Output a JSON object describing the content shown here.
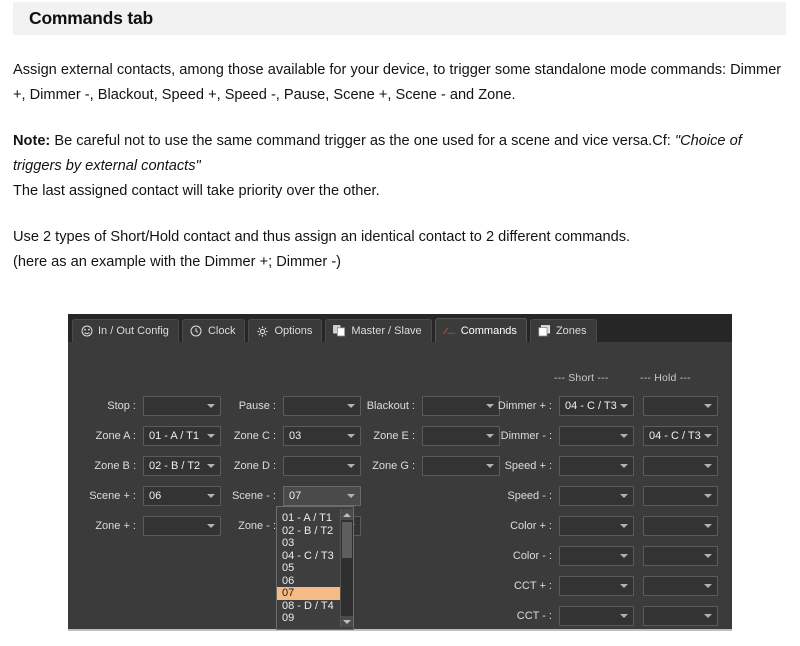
{
  "document": {
    "title": "Commands tab",
    "paragraphs": [
      {
        "id": "p1",
        "text": "Assign external contacts, among those available for your device, to trigger some standalone mode commands: Dimmer +, Dimmer -, Blackout, Speed +, Speed -, Pause, Scene +, Scene - and Zone."
      },
      {
        "id": "p2_note_label",
        "text": "Note:"
      },
      {
        "id": "p2_note_body",
        "text": " Be careful not to use the same command trigger as the one used for a scene and vice versa.Cf: "
      },
      {
        "id": "p2_note_quote",
        "text": "\"Choice of triggers by external contacts\""
      },
      {
        "id": "p3",
        "text": "The last assigned contact will take priority over the other."
      },
      {
        "id": "p4",
        "text": "Use 2 types of Short/Hold contact and thus assign an identical contact to 2 different commands."
      },
      {
        "id": "p5",
        "text": "(here as an example with the Dimmer +; Dimmer -)"
      }
    ]
  },
  "app": {
    "tabs": [
      {
        "label": "In / Out Config",
        "icon": "in-out-config-icon",
        "active": false
      },
      {
        "label": "Clock",
        "icon": "clock-icon",
        "active": false
      },
      {
        "label": "Options",
        "icon": "gear-icon",
        "active": false
      },
      {
        "label": "Master / Slave",
        "icon": "master-slave-icon",
        "active": false
      },
      {
        "label": "Commands",
        "icon": "commands-icon",
        "active": true
      },
      {
        "label": "Zones",
        "icon": "zones-icon",
        "active": false
      }
    ],
    "column_headers": {
      "short": "--- Short ---",
      "hold": "--- Hold ---"
    },
    "fields": {
      "stop": {
        "label": "Stop :",
        "value": ""
      },
      "zone_a": {
        "label": "Zone A :",
        "value": "01 - A / T1"
      },
      "zone_b": {
        "label": "Zone B :",
        "value": "02 - B / T2"
      },
      "scene_plus": {
        "label": "Scene + :",
        "value": "06"
      },
      "zone_plus": {
        "label": "Zone + :",
        "value": ""
      },
      "pause": {
        "label": "Pause :",
        "value": ""
      },
      "zone_c": {
        "label": "Zone C :",
        "value": "03"
      },
      "zone_d": {
        "label": "Zone D :",
        "value": ""
      },
      "scene_minus": {
        "label": "Scene - :",
        "value": "07"
      },
      "zone_minus": {
        "label": "Zone - :",
        "value": ""
      },
      "blackout": {
        "label": "Blackout :",
        "value": ""
      },
      "zone_e": {
        "label": "Zone E :",
        "value": ""
      },
      "zone_g": {
        "label": "Zone G :",
        "value": ""
      },
      "dimmer_plus": {
        "label": "Dimmer + :",
        "short": "04 - C / T3",
        "hold": ""
      },
      "dimmer_minus": {
        "label": "Dimmer - :",
        "short": "",
        "hold": "04 - C / T3"
      },
      "speed_plus": {
        "label": "Speed + :",
        "short": "",
        "hold": ""
      },
      "speed_minus": {
        "label": "Speed - :",
        "short": "",
        "hold": ""
      },
      "color_plus": {
        "label": "Color + :",
        "short": "",
        "hold": ""
      },
      "color_minus": {
        "label": "Color - :",
        "short": "",
        "hold": ""
      },
      "cct_plus": {
        "label": "CCT + :",
        "short": "",
        "hold": ""
      },
      "cct_minus": {
        "label": "CCT - :",
        "short": "",
        "hold": ""
      }
    },
    "dropdown": {
      "open_for": "scene_minus",
      "selected": "07",
      "items": [
        "01 - A / T1",
        "02 - B / T2",
        "03",
        "04 - C / T3",
        "05",
        "06",
        "07",
        "08 - D / T4",
        "09"
      ]
    },
    "colors": {
      "panel_bg": "#3b3b3b",
      "tabstrip_bg": "#262626",
      "combo_bg": "#333333",
      "combo_border": "#5b5b5b",
      "highlight": "#f6bb84",
      "text": "#dcdcdc"
    }
  }
}
